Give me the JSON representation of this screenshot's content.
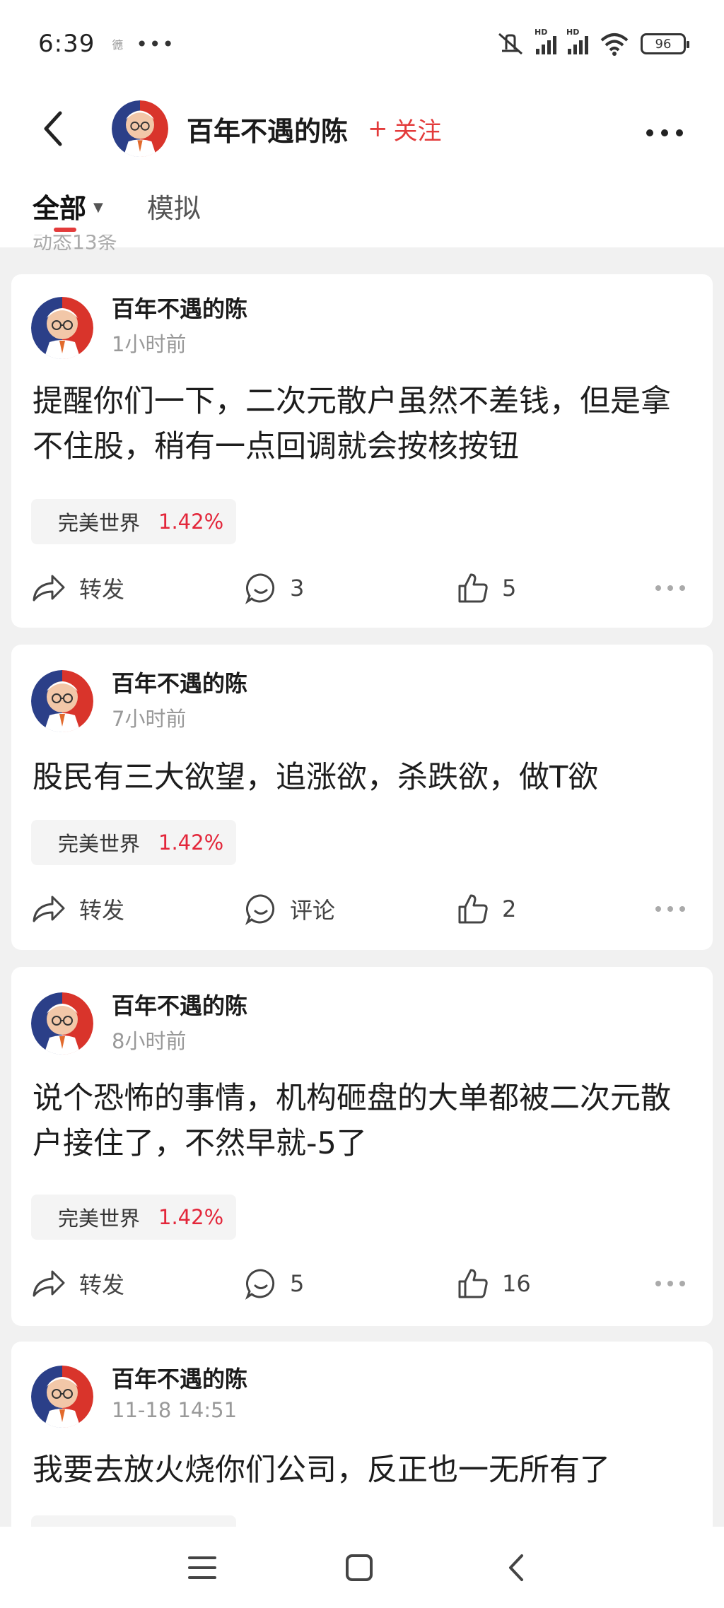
{
  "status_bar": {
    "time": "6:39",
    "small_icon": "㣹",
    "dots": "•••",
    "battery": "96"
  },
  "header": {
    "name": "百年不遇的陈",
    "follow": "关注",
    "follow_plus": "+"
  },
  "tabs": [
    {
      "label": "全部",
      "active": true
    },
    {
      "label": "模拟",
      "active": false
    }
  ],
  "post_count_text": "动态13条",
  "posts": [
    {
      "author": "百年不遇的陈",
      "time": "1小时前",
      "content": "提醒你们一下，二次元散户虽然不差钱，但是拿不住股，稍有一点回调就会按核按钮",
      "stock": "完美世界",
      "pct": "1.42%",
      "forward": "转发",
      "comment": "3",
      "like": "5"
    },
    {
      "author": "百年不遇的陈",
      "time": "7小时前",
      "content": "股民有三大欲望，追涨欲，杀跌欲，做T欲",
      "stock": "完美世界",
      "pct": "1.42%",
      "forward": "转发",
      "comment": "评论",
      "like": "2"
    },
    {
      "author": "百年不遇的陈",
      "time": "8小时前",
      "content": "说个恐怖的事情，机构砸盘的大单都被二次元散户接住了，不然早就-5了",
      "stock": "完美世界",
      "pct": "1.42%",
      "forward": "转发",
      "comment": "5",
      "like": "16"
    },
    {
      "author": "百年不遇的陈",
      "time": "11-18 14:51",
      "content": "我要去放火烧你们公司，反正也一无所有了"
    }
  ],
  "colors": {
    "accent_red": "#e33b3b",
    "stock_up": "#e3263a",
    "background": "#f1f1f1"
  },
  "icons": [
    "back-icon",
    "more-icon",
    "forward-icon",
    "comment-icon",
    "like-icon",
    "menu-icon",
    "home-icon",
    "nav-back-icon"
  ]
}
